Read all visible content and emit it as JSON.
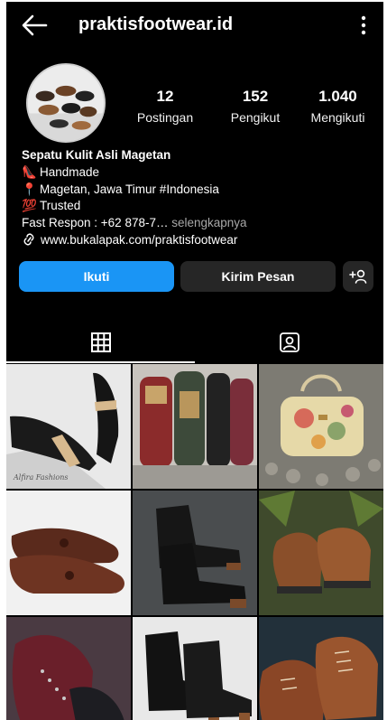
{
  "header": {
    "username": "praktisfootwear.id",
    "back_icon": "back-arrow-icon",
    "more_icon": "more-vertical-icon"
  },
  "stats": [
    {
      "value": "12",
      "label": "Postingan"
    },
    {
      "value": "152",
      "label": "Pengikut"
    },
    {
      "value": "1.040",
      "label": "Mengikuti"
    }
  ],
  "bio": {
    "name": "Sepatu Kulit Asli Magetan",
    "line1_emoji": "👠",
    "line1": "Handmade",
    "line2_emoji": "📍",
    "line2": "Magetan, Jawa Timur #Indonesia",
    "line3_emoji": "💯",
    "line3": "Trusted",
    "line4": "Fast Respon : +62 878-7…",
    "more": " selengkapnya",
    "link": "www.bukalapak.com/praktisfootwear"
  },
  "actions": {
    "follow": "Ikuti",
    "message": "Kirim Pesan",
    "suggest_icon": "add-person-icon"
  },
  "tabs": [
    {
      "icon": "grid-icon",
      "active": true
    },
    {
      "icon": "tagged-person-icon",
      "active": false
    }
  ],
  "posts": [
    {
      "subject": "black and beige flat shoes",
      "caption": "Alfira Fashions"
    },
    {
      "subject": "batik fabric shoes"
    },
    {
      "subject": "floral print leather handbag"
    },
    {
      "subject": "brown tassel loafers"
    },
    {
      "subject": "black ankle boots"
    },
    {
      "subject": "tan lace-up shoes"
    },
    {
      "subject": "burgundy leather boots"
    },
    {
      "subject": "black heeled ankle boots"
    },
    {
      "subject": "brown lace-up boots"
    }
  ],
  "colors": {
    "background": "#000000",
    "follow_button": "#1a95f5",
    "secondary_button": "#262626"
  }
}
